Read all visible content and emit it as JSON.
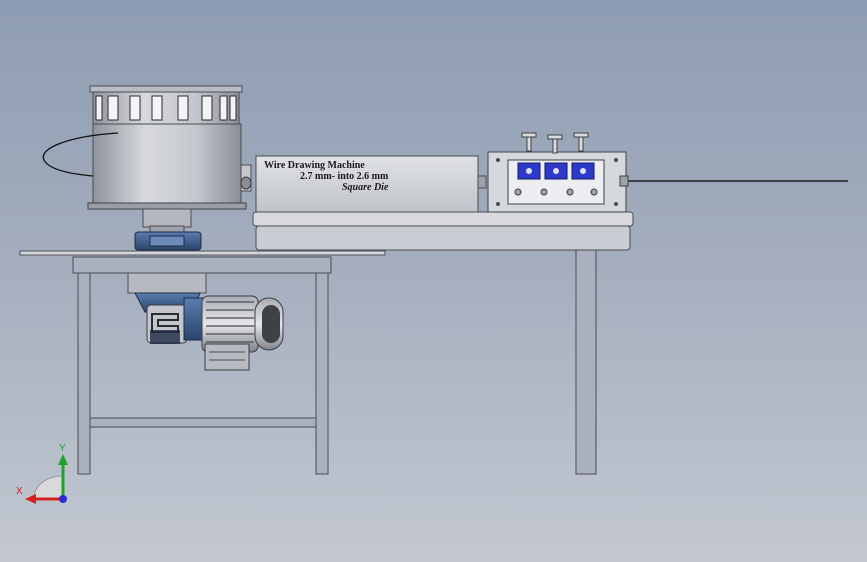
{
  "model": {
    "label_line1": "Wire Drawing Machine",
    "label_line2": "2.7 mm- into 2.6 mm",
    "label_line3": "Square Die"
  },
  "triad": {
    "x_axis": "X",
    "y_axis": "Y"
  },
  "colors": {
    "background_top": "#8e9cb3",
    "background_bottom": "#c3c8d1",
    "steel": "#c9ccd3",
    "steel_dark": "#8b8f98",
    "motor_blue": "#3a5a86",
    "die_blue": "#2d39c9",
    "axis_x": "#d42020",
    "axis_y": "#1fa22b",
    "axis_z": "#2b2bd4"
  }
}
